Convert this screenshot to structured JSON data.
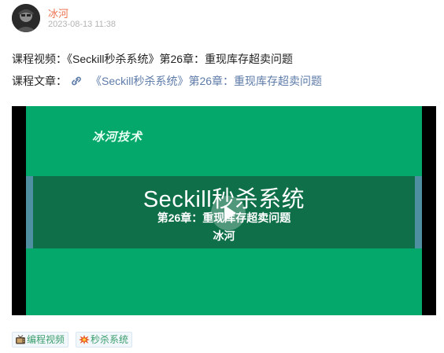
{
  "author": {
    "name": "冰河",
    "time": "2023-08-13 11:38"
  },
  "post": {
    "video_label": "课程视频：",
    "video_text": "《Seckill秒杀系统》第26章：重现库存超卖问题",
    "article_label": "课程文章：",
    "article_link": "《Seckill秒杀系统》第26章：重现库存超卖问题"
  },
  "video": {
    "brand": "冰河技术",
    "title": "Seckill秒杀系统",
    "subtitle": "第26章：重现库存超卖问题",
    "author": "冰河"
  },
  "tags": [
    {
      "label": "编程视频",
      "icon": "tv-icon"
    },
    {
      "label": "秒杀系统",
      "icon": "explosion-icon"
    }
  ],
  "colors": {
    "author_name": "#eb7350",
    "link": "#5d7ba8",
    "video_bg": "#03a86a",
    "video_band": "#0e6f49",
    "tag_text": "#3b9e6d"
  }
}
